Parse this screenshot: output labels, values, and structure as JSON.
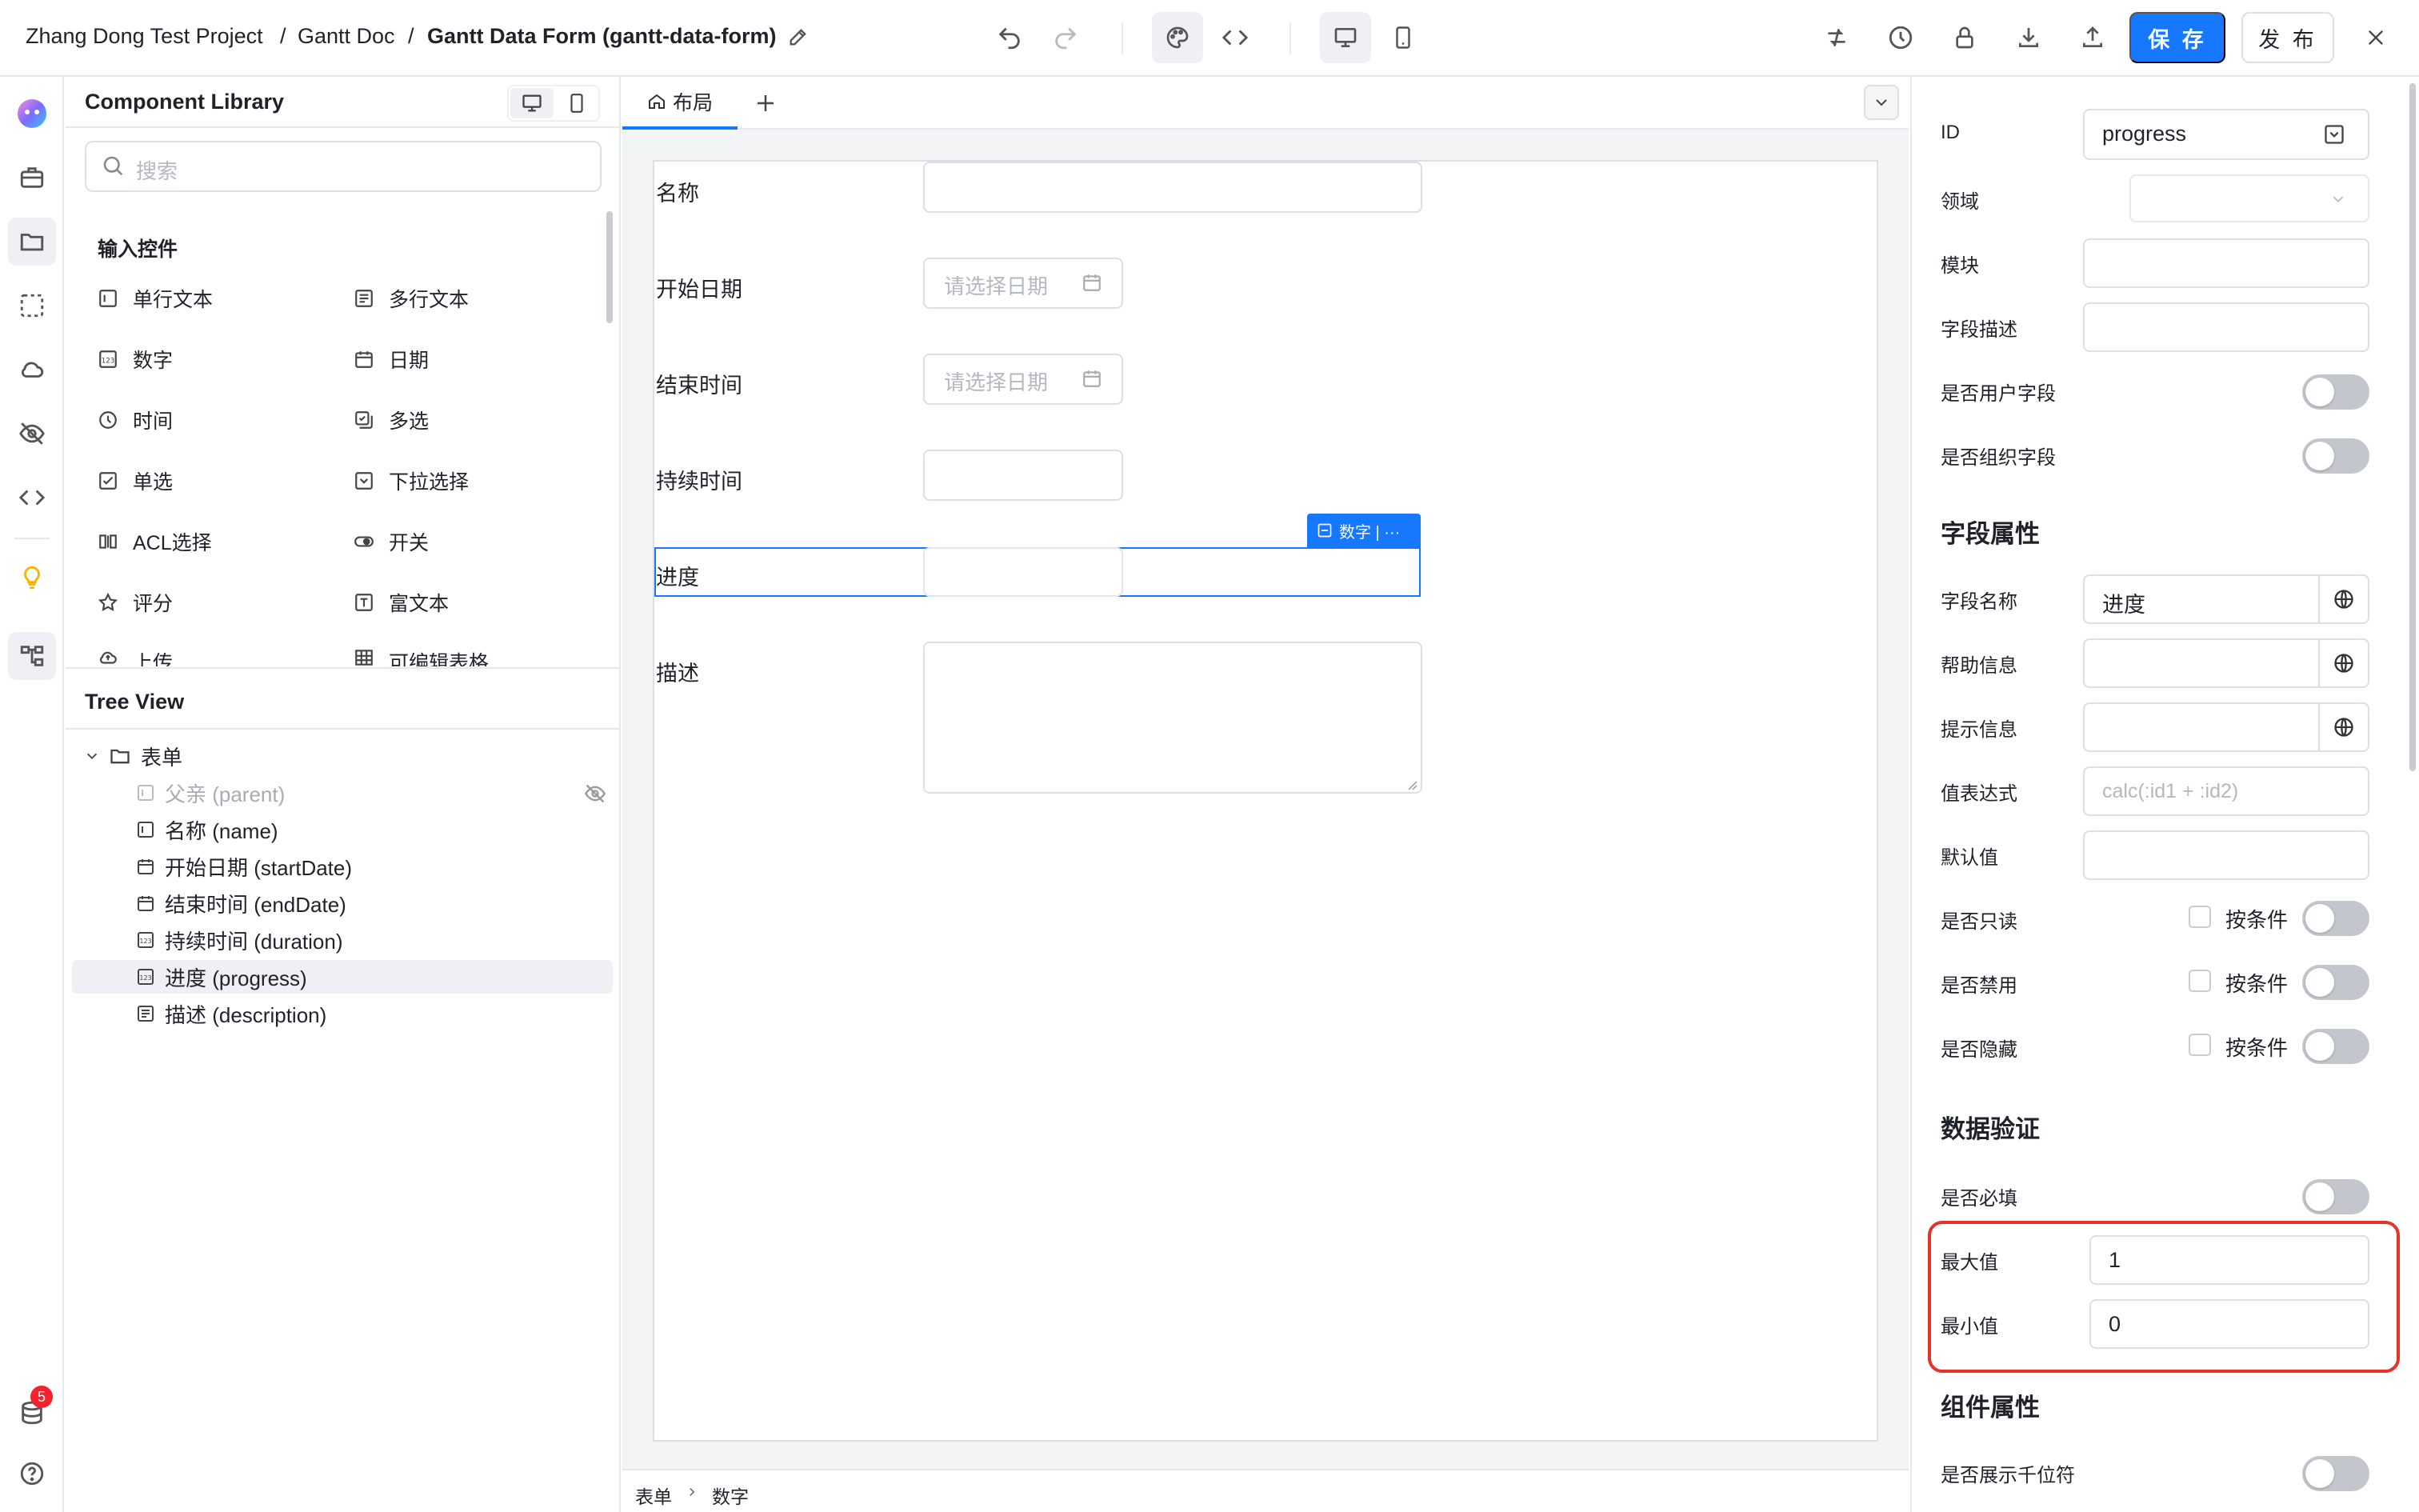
{
  "header": {
    "breadcrumb": [
      "Zhang Dong Test Project",
      "Gantt Doc",
      "Gantt Data Form (gantt-data-form)"
    ],
    "separator": "/",
    "save_label": "保 存",
    "publish_label": "发 布",
    "icons": [
      "edit-icon",
      "undo-icon",
      "redo-icon",
      "palette-icon",
      "code-icon",
      "desktop-icon",
      "mobile-icon",
      "compare-icon",
      "history-icon",
      "lock-icon",
      "download-icon",
      "upload-icon",
      "close-icon"
    ],
    "accent_color": "#1677ff"
  },
  "rail": {
    "icons": [
      "logo-icon",
      "briefcase-icon",
      "folder-icon",
      "dashed-select-icon",
      "cloud-icon",
      "eye-off-icon",
      "code-icon",
      "bulb-icon",
      "tree-icon",
      "database-icon",
      "help-icon"
    ],
    "badge_count": "5"
  },
  "library": {
    "title": "Component Library",
    "search_placeholder": "搜索",
    "category": "输入控件",
    "items": [
      {
        "label": "单行文本",
        "icon": "single-line-icon"
      },
      {
        "label": "多行文本",
        "icon": "multi-line-icon"
      },
      {
        "label": "数字",
        "icon": "number-icon"
      },
      {
        "label": "日期",
        "icon": "calendar-icon"
      },
      {
        "label": "时间",
        "icon": "clock-icon"
      },
      {
        "label": "多选",
        "icon": "multi-select-icon"
      },
      {
        "label": "单选",
        "icon": "checkbox-icon"
      },
      {
        "label": "下拉选择",
        "icon": "dropdown-icon"
      },
      {
        "label": "ACL选择",
        "icon": "acl-icon"
      },
      {
        "label": "开关",
        "icon": "toggle-icon"
      },
      {
        "label": "评分",
        "icon": "star-icon"
      },
      {
        "label": "富文本",
        "icon": "rich-text-icon"
      },
      {
        "label": "上传",
        "icon": "upload-icon"
      },
      {
        "label": "可编辑表格",
        "icon": "table-icon"
      }
    ]
  },
  "tree": {
    "title": "Tree View",
    "root": "表单",
    "nodes": [
      {
        "label": "父亲 (parent)",
        "icon": "single-line-icon",
        "hidden": true
      },
      {
        "label": "名称 (name)",
        "icon": "single-line-icon"
      },
      {
        "label": "开始日期 (startDate)",
        "icon": "calendar-icon"
      },
      {
        "label": "结束时间 (endDate)",
        "icon": "calendar-icon"
      },
      {
        "label": "持续时间 (duration)",
        "icon": "number-icon"
      },
      {
        "label": "进度 (progress)",
        "icon": "number-icon",
        "selected": true
      },
      {
        "label": "描述 (description)",
        "icon": "multi-line-icon"
      }
    ]
  },
  "canvas": {
    "tab_label": "布局",
    "fields": [
      {
        "label": "名称"
      },
      {
        "label": "开始日期",
        "placeholder": "请选择日期"
      },
      {
        "label": "结束时间",
        "placeholder": "请选择日期"
      },
      {
        "label": "持续时间"
      },
      {
        "label": "进度"
      },
      {
        "label": "描述"
      }
    ],
    "selection_tag": "数字 | ···",
    "breadcrumb": [
      "表单",
      "数字"
    ]
  },
  "props": {
    "id_label": "ID",
    "id_value": "progress",
    "domain_label": "领域",
    "module_label": "模块",
    "field_desc_label": "字段描述",
    "is_user_field": "是否用户字段",
    "is_org_field": "是否组织字段",
    "section_field_props": "字段属性",
    "field_name_label": "字段名称",
    "field_name_value": "进度",
    "help_label": "帮助信息",
    "hint_label": "提示信息",
    "value_expr_label": "值表达式",
    "value_expr_placeholder": "calc(:id1 + :id2)",
    "default_label": "默认值",
    "readonly_label": "是否只读",
    "disabled_label": "是否禁用",
    "hidden_label": "是否隐藏",
    "conditional_label": "按条件",
    "section_validation": "数据验证",
    "required_label": "是否必填",
    "max_label": "最大值",
    "max_value": "1",
    "min_label": "最小值",
    "min_value": "0",
    "section_component_props": "组件属性",
    "thousands_label": "是否展示千位符",
    "highlight_color": "#e5332a"
  }
}
